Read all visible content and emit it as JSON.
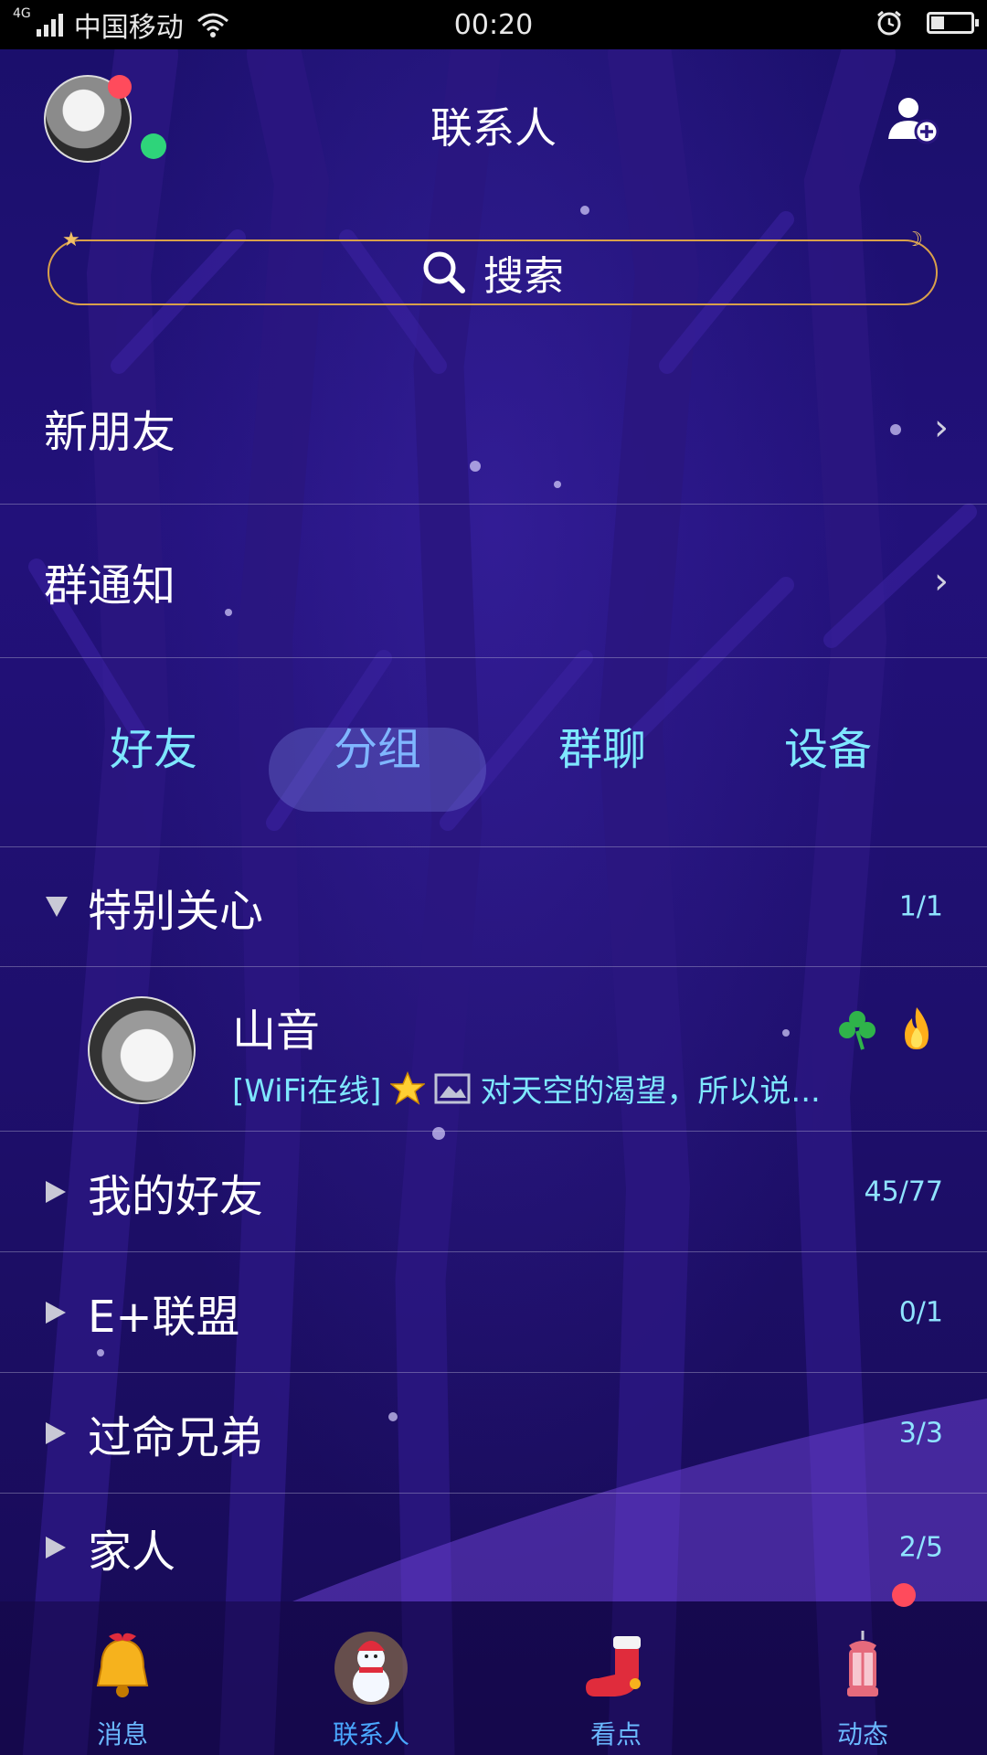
{
  "status_bar": {
    "network": "4G",
    "carrier": "中国移动",
    "time": "00:20",
    "battery_level": 0.3
  },
  "header": {
    "title": "联系人",
    "add_contact_icon": "add-contact-icon"
  },
  "search": {
    "label": "搜索",
    "icon": "search-icon"
  },
  "menu": [
    {
      "label": "新朋友"
    },
    {
      "label": "群通知"
    }
  ],
  "tabs": [
    {
      "label": "好友",
      "active": false
    },
    {
      "label": "分组",
      "active": true
    },
    {
      "label": "群聊",
      "active": false
    },
    {
      "label": "设备",
      "active": false
    }
  ],
  "groups": {
    "special": {
      "name": "特别关心",
      "count": "1/1",
      "expanded": true
    },
    "items": [
      {
        "name": "我的好友",
        "count": "45/77"
      },
      {
        "name": "E+联盟",
        "count": "0/1"
      },
      {
        "name": "过命兄弟",
        "count": "3/3"
      },
      {
        "name": "家人",
        "count": "2/5"
      }
    ]
  },
  "contact": {
    "name": "山音",
    "status_prefix": "[WiFi在线]",
    "status_text": "对天空的渴望，所以说..."
  },
  "bottom_nav": [
    {
      "label": "消息",
      "icon": "bell-icon"
    },
    {
      "label": "联系人",
      "icon": "snowman-icon",
      "active": true
    },
    {
      "label": "看点",
      "icon": "stocking-icon"
    },
    {
      "label": "动态",
      "icon": "lantern-icon"
    }
  ],
  "colors": {
    "accent_cyan": "#7ee7ff",
    "active_tab": "#7fb6ff",
    "badge_red": "#ff4b5c",
    "online_green": "#2ed47a",
    "search_border": "#d9a04a"
  }
}
